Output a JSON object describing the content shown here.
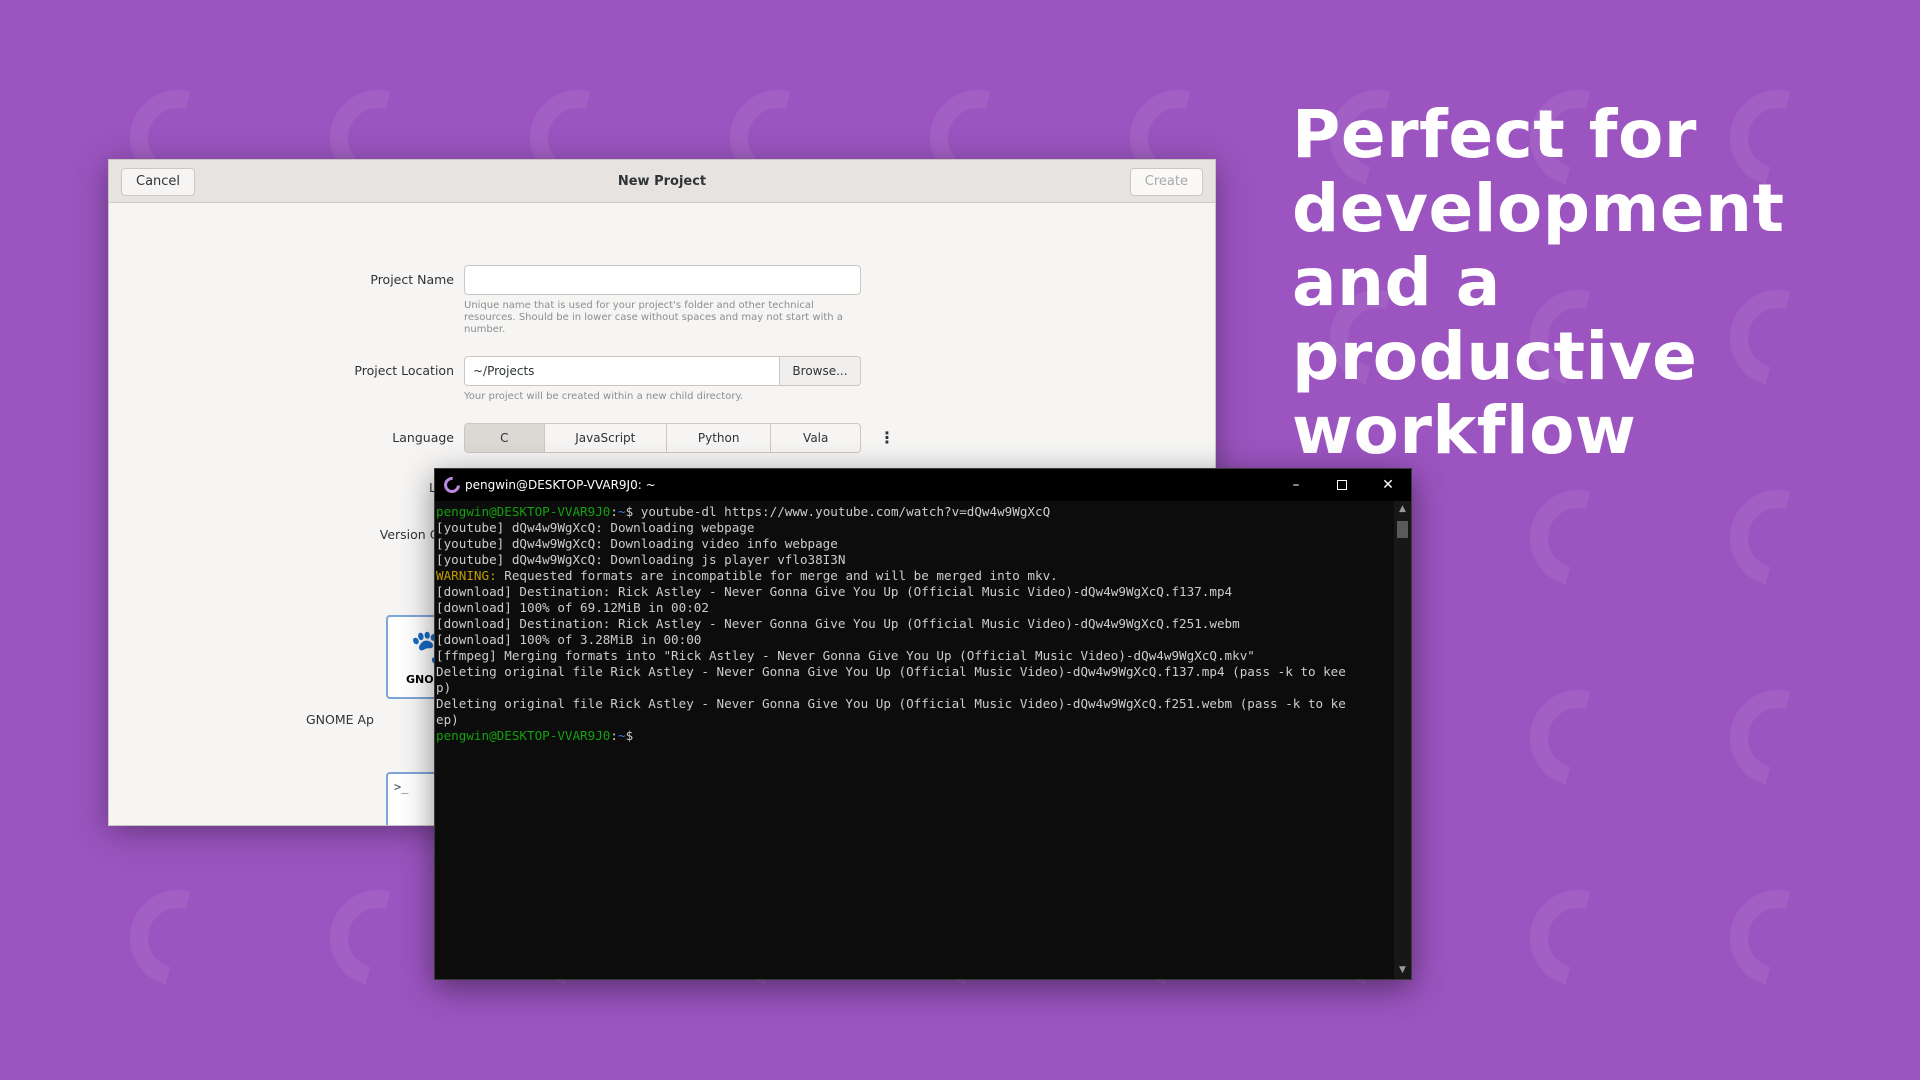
{
  "headline": {
    "line1": "Perfect for",
    "line2": "development",
    "line3": "and a productive",
    "line4": "workflow"
  },
  "dialog": {
    "cancel_label": "Cancel",
    "title": "New Project",
    "create_label": "Create",
    "project_name_label": "Project Name",
    "project_name_value": "",
    "project_name_hint": "Unique name that is used for your project's folder and other technical resources. Should be in lower case without spaces and may not start with a number.",
    "project_location_label": "Project Location",
    "project_location_value": "~/Projects",
    "browse_label": "Browse...",
    "project_location_hint": "Your project will be created within a new child directory.",
    "language_label": "Language",
    "languages": [
      "C",
      "JavaScript",
      "Python",
      "Vala"
    ],
    "selected_language": "C",
    "license_label_partial": "Lice",
    "version_control_label_partial": "Version Con",
    "template_gnome_logo_text": "GNO",
    "template_gnome_label_partial": "GNOME Ap",
    "template_terminal_glyph": ">_"
  },
  "terminal": {
    "title": "pengwin@DESKTOP-VVAR9J0: ~",
    "lines": [
      {
        "prompt": "pengwin@DESKTOP-VVAR9J0",
        "path": "~",
        "cmd": "$ youtube-dl https://www.youtube.com/watch?v=dQw4w9WgXcQ"
      },
      {
        "text": "[youtube] dQw4w9WgXcQ: Downloading webpage"
      },
      {
        "text": "[youtube] dQw4w9WgXcQ: Downloading video info webpage"
      },
      {
        "text": "[youtube] dQw4w9WgXcQ: Downloading js player vflo38I3N"
      },
      {
        "warn": "WARNING:",
        "text": " Requested formats are incompatible for merge and will be merged into mkv."
      },
      {
        "text": "[download] Destination: Rick Astley - Never Gonna Give You Up (Official Music Video)-dQw4w9WgXcQ.f137.mp4"
      },
      {
        "text": "[download] 100% of 69.12MiB in 00:02"
      },
      {
        "text": "[download] Destination: Rick Astley - Never Gonna Give You Up (Official Music Video)-dQw4w9WgXcQ.f251.webm"
      },
      {
        "text": "[download] 100% of 3.28MiB in 00:00"
      },
      {
        "text": "[ffmpeg] Merging formats into \"Rick Astley - Never Gonna Give You Up (Official Music Video)-dQw4w9WgXcQ.mkv\""
      },
      {
        "text": "Deleting original file Rick Astley - Never Gonna Give You Up (Official Music Video)-dQw4w9WgXcQ.f137.mp4 (pass -k to kee"
      },
      {
        "text": "p)"
      },
      {
        "text": "Deleting original file Rick Astley - Never Gonna Give You Up (Official Music Video)-dQw4w9WgXcQ.f251.webm (pass -k to ke"
      },
      {
        "text": "ep)"
      },
      {
        "prompt": "pengwin@DESKTOP-VVAR9J0",
        "path": "~",
        "cmd": "$"
      }
    ]
  },
  "colors": {
    "background": "#9b54c0",
    "prompt_green": "#13a10e",
    "path_blue": "#3b78ff",
    "warning_yellow": "#c19c00"
  },
  "icons": {
    "minimize": "minimize-icon",
    "maximize": "maximize-icon",
    "close": "close-icon",
    "app": "pengwin-logo-icon",
    "kebab": "more-options-icon"
  }
}
